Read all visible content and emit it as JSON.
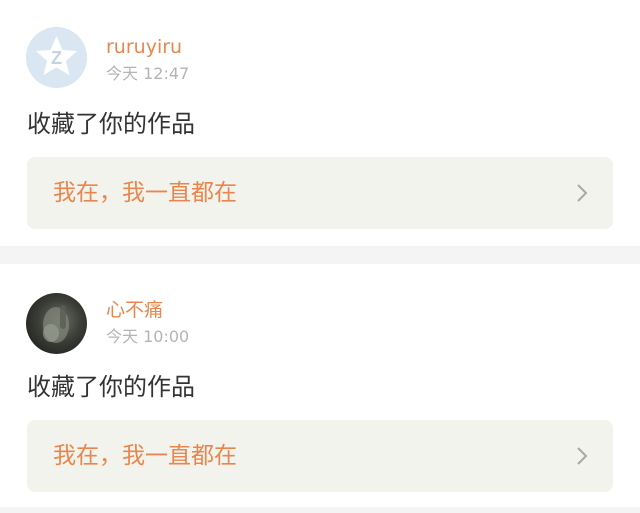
{
  "posts": [
    {
      "username": "ruruyiru",
      "time": "今天 12:47",
      "action": "收藏了你的作品",
      "work_title": "我在，我一直都在",
      "avatar_icon": "default-qq-avatar-icon"
    },
    {
      "username": "心不痛",
      "time": "今天 10:00",
      "action": "收藏了你的作品",
      "work_title": "我在，我一直都在",
      "avatar_icon": "user-photo-avatar"
    }
  ],
  "colors": {
    "username": "#e8874d",
    "work_title": "#e8874d",
    "time": "#b4b4b4",
    "action": "#333333",
    "link_bg": "#f3f3ee",
    "separator": "#f4f4f4"
  }
}
